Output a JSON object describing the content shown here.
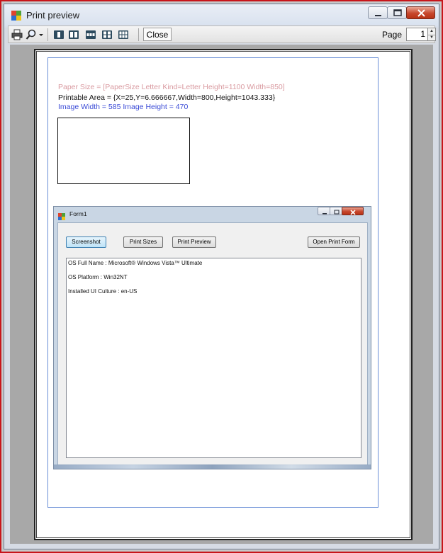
{
  "window": {
    "title": "Print preview"
  },
  "toolbar": {
    "close_label": "Close",
    "page_label": "Page",
    "page_value": "1",
    "icons": [
      "printer-icon",
      "zoom-icon",
      "chevron-down-icon",
      "one-page-icon",
      "two-pages-icon",
      "three-pages-icon",
      "four-pages-icon",
      "six-pages-icon"
    ]
  },
  "document": {
    "paper_size_line": "Paper Size = [PaperSize Letter Kind=Letter Height=1100 Width=850]",
    "printable_area_line": "Printable Area = {X=25,Y=6.666667,Width=800,Height=1043.333}",
    "image_size_line": "Image Width = 585   Image Height = 470",
    "colors": {
      "paper_size": "#d99aa0",
      "printable_area": "#111111",
      "image_size": "#3b4bd6",
      "margin_border": "#6a8fd6"
    }
  },
  "form1": {
    "title": "Form1",
    "buttons": {
      "screenshot": "Screenshot",
      "print_sizes": "Print Sizes",
      "print_preview": "Print Preview",
      "open_print_form": "Open Print Form"
    },
    "lines": [
      "OS Full Name : Microsoft® Windows Vista™ Ultimate",
      "OS Platform : Win32NT",
      "Installed UI Culture : en-US"
    ]
  }
}
